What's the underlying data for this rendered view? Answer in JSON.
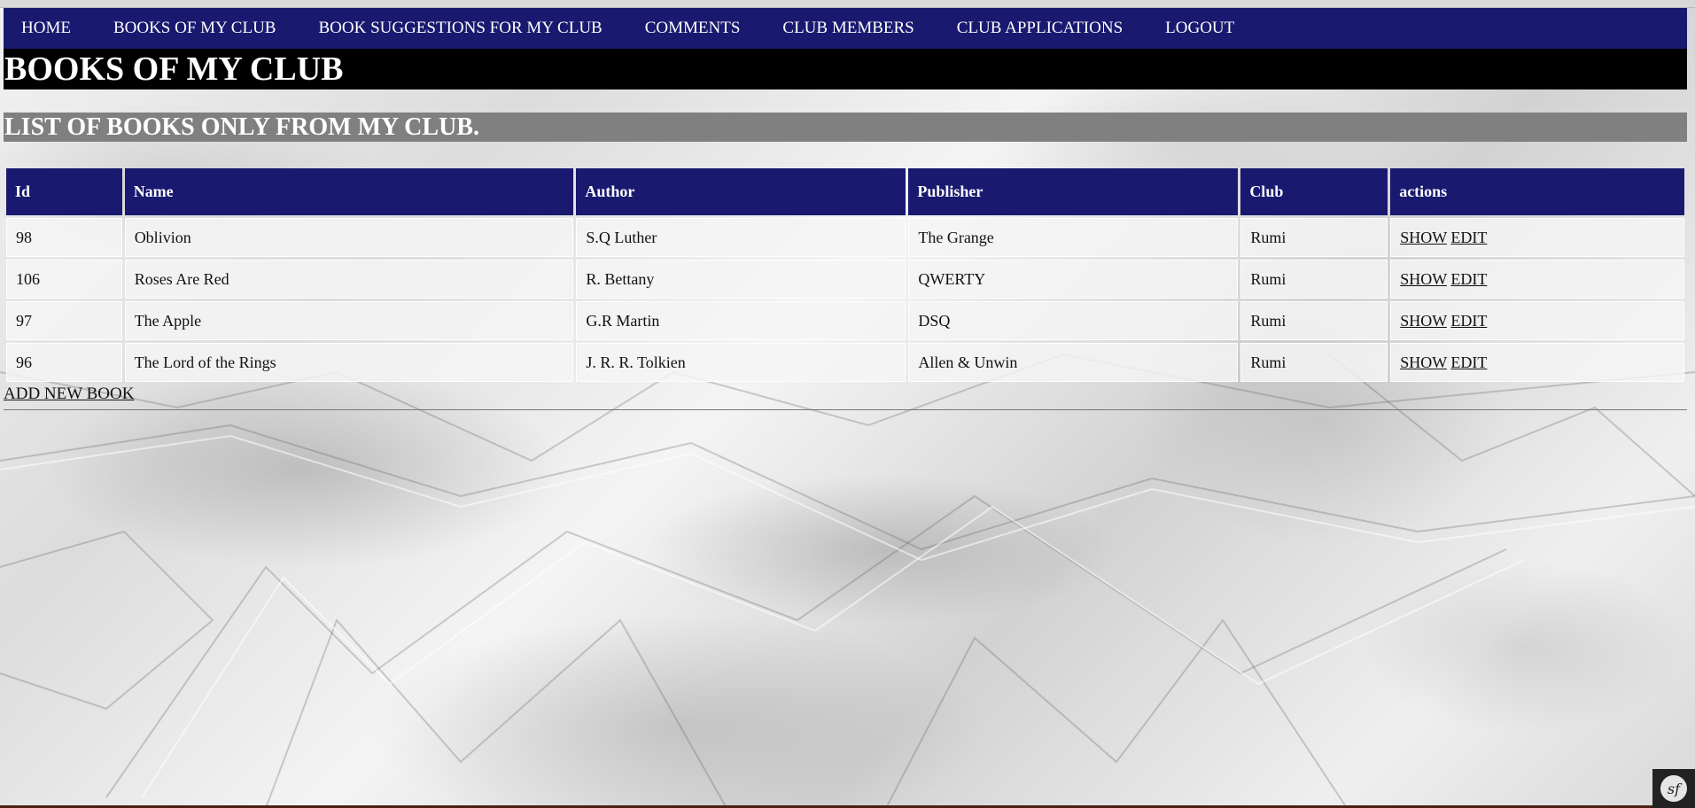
{
  "nav": {
    "items": [
      {
        "label": "HOME"
      },
      {
        "label": "BOOKS OF MY CLUB"
      },
      {
        "label": "BOOK SUGGESTIONS FOR MY CLUB"
      },
      {
        "label": "COMMENTS"
      },
      {
        "label": "CLUB MEMBERS"
      },
      {
        "label": "CLUB APPLICATIONS"
      },
      {
        "label": "LOGOUT"
      }
    ]
  },
  "page": {
    "title": "BOOKS OF MY CLUB",
    "subtitle": "LIST OF BOOKS ONLY FROM MY CLUB."
  },
  "table": {
    "headers": [
      "Id",
      "Name",
      "Author",
      "Publisher",
      "Club",
      "actions"
    ],
    "rows": [
      {
        "id": "98",
        "name": "Oblivion",
        "author": "S.Q Luther",
        "publisher": "The Grange",
        "club": "Rumi",
        "show": "SHOW",
        "edit": "EDIT"
      },
      {
        "id": "106",
        "name": "Roses Are Red",
        "author": "R. Bettany",
        "publisher": "QWERTY",
        "club": "Rumi",
        "show": "SHOW",
        "edit": "EDIT"
      },
      {
        "id": "97",
        "name": "The Apple",
        "author": "G.R Martin",
        "publisher": "DSQ",
        "club": "Rumi",
        "show": "SHOW",
        "edit": "EDIT"
      },
      {
        "id": "96",
        "name": "The Lord of the Rings",
        "author": "J. R. R. Tolkien",
        "publisher": "Allen & Unwin",
        "club": "Rumi",
        "show": "SHOW",
        "edit": "EDIT"
      }
    ]
  },
  "footer": {
    "add_link": "ADD NEW BOOK"
  },
  "debug_toolbar": {
    "logo_text": "sf",
    "icon": "symfony-logo-icon"
  },
  "colors": {
    "nav_bg": "#191970",
    "title_bg": "#000000",
    "subtitle_bg": "#808080",
    "header_bg": "#191970"
  }
}
